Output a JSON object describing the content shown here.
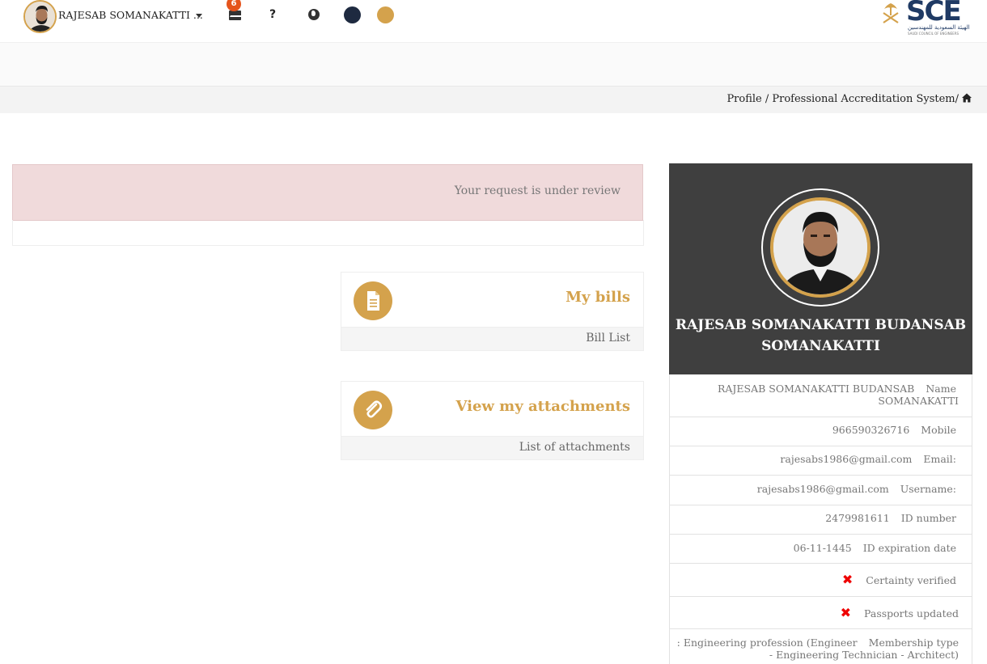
{
  "navbar": {
    "user_name": "RAJESAB SOMANAKATTI ...",
    "mail_count": "6",
    "help_label": "?",
    "logo_text": "SCE",
    "logo_subtitle": "الهيئة السعودية للمهندسين",
    "logo_subtitle_en": "SAUDI COUNCIL OF ENGINEERS"
  },
  "breadcrumb": {
    "text": "Profile / Professional Accreditation System/"
  },
  "alert": {
    "message": "Your request is under review"
  },
  "cards": [
    {
      "title": "My bills",
      "link": "Bill List",
      "icon": "document-icon"
    },
    {
      "title": "View my attachments",
      "link": "List of attachments",
      "icon": "paperclip-icon"
    }
  ],
  "profile": {
    "full_name": "RAJESAB SOMANAKATTI BUDANSAB SOMANAKATTI",
    "fields": {
      "name_label": "Name",
      "name_value_line1": "RAJESAB SOMANAKATTI BUDANSAB",
      "name_value_line2": "SOMANAKATTI",
      "mobile_label": "Mobile",
      "mobile_value": "966590326716",
      "email_label": "Email:",
      "email_value": "rajesabs1986@gmail.com",
      "username_label": "Username:",
      "username_value": "rajesabs1986@gmail.com",
      "id_label": "ID number",
      "id_value": "2479981611",
      "id_exp_label": "ID expiration date",
      "id_exp_value": "06-11-1445",
      "certainty_label": "Certainty verified",
      "passports_label": "Passports updated",
      "membership_label": "Membership type",
      "membership_value_line1": ": Engineering profession (Engineer",
      "membership_value_line2": "- Engineering Technician - Architect)"
    }
  },
  "colors": {
    "accent_gold": "#d4a24c",
    "dark_theme": "#1e2a40",
    "alert_bg": "#f0dadb",
    "profile_header": "#3f3f3f",
    "error_red": "#e00000"
  }
}
